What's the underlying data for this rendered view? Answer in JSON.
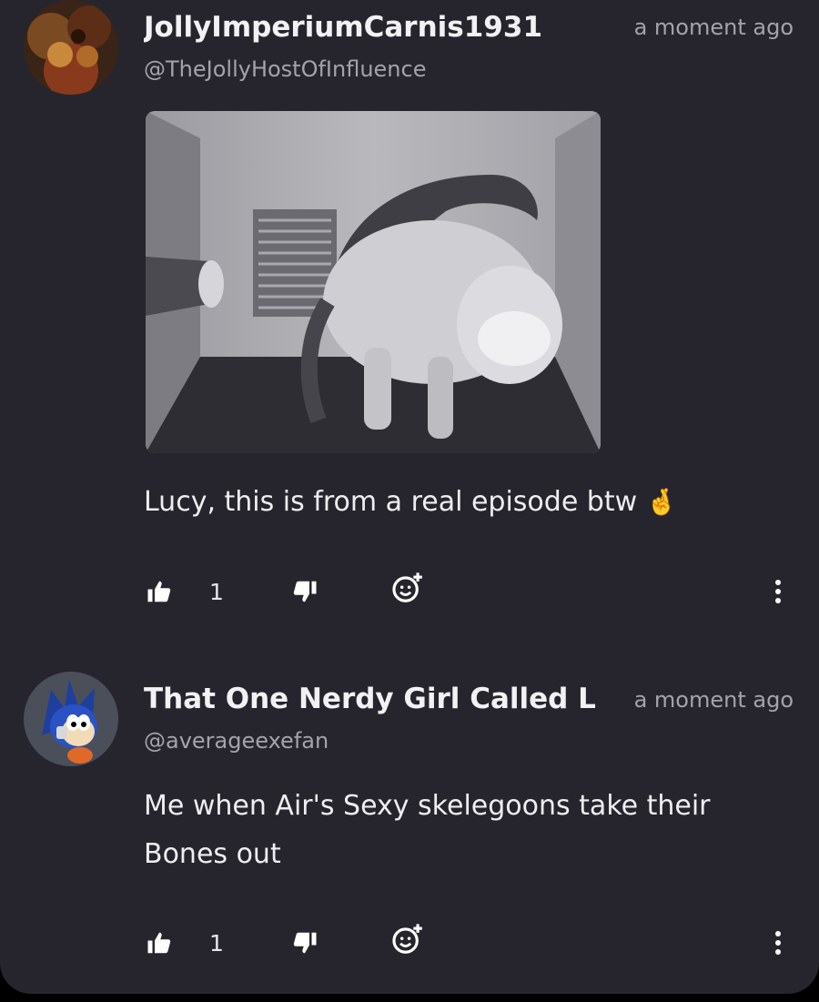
{
  "comments": [
    {
      "username": "JollyImperiumCarnis1931",
      "handle": "@TheJollyHostOfInfluence",
      "time": "a moment ago",
      "text": "Lucy, this is from a real episode btw",
      "emoji": "🤞",
      "likes": "1"
    },
    {
      "username": "That One Nerdy Girl Called L",
      "handle": "@averageexefan",
      "time": "a moment ago",
      "text_line1": "Me when Air's Sexy skelegoons take their",
      "text_line2": "Bones out",
      "likes": "1"
    }
  ],
  "icons": {
    "like": "thumbs-up-icon",
    "dislike": "thumbs-down-icon",
    "reply": "add-reaction-icon",
    "more": "more-vertical-icon"
  },
  "colors": {
    "background": "#26252d",
    "text": "#f2f2f4",
    "muted": "#a3a3ab"
  }
}
